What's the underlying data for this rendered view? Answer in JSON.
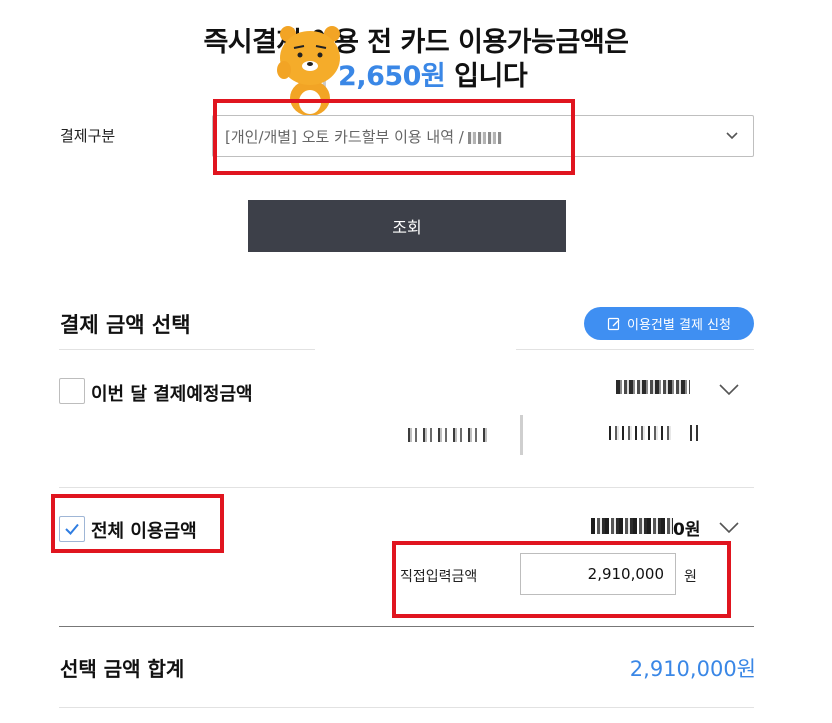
{
  "header": {
    "line1": "즉시결제 이용 전 카드 이용가능금액은",
    "line2_prefix": "금",
    "line2_amount": "2,650원",
    "line2_suffix": " 입니다"
  },
  "form": {
    "payment_type_label": "결제구분",
    "payment_type_value": "[개인/개별] 오토 카드할부 이용 내역 /",
    "search_button": "조회"
  },
  "section": {
    "title": "결제 금액 선택",
    "apply_button": "이용건별 결제 신청"
  },
  "rows": {
    "monthly_label": "이번 달 결제예정금액",
    "monthly_checked": false,
    "total_label": "전체 이용금액",
    "total_checked": true,
    "total_won_suffix": "0원"
  },
  "direct_input": {
    "label": "직접입력금액",
    "value": "2,910,000",
    "unit": "원"
  },
  "summary": {
    "label": "선택 금액 합계",
    "value": "2,910,000원"
  },
  "colors": {
    "accent_blue": "#3a87e6",
    "button_dark": "#3d4049",
    "annotation_red": "#e0151f"
  },
  "icons": {
    "mascot": "bear-mascot-icon",
    "select_chevron": "chevron-down-icon",
    "apply": "edit-document-icon",
    "check": "check-icon"
  }
}
